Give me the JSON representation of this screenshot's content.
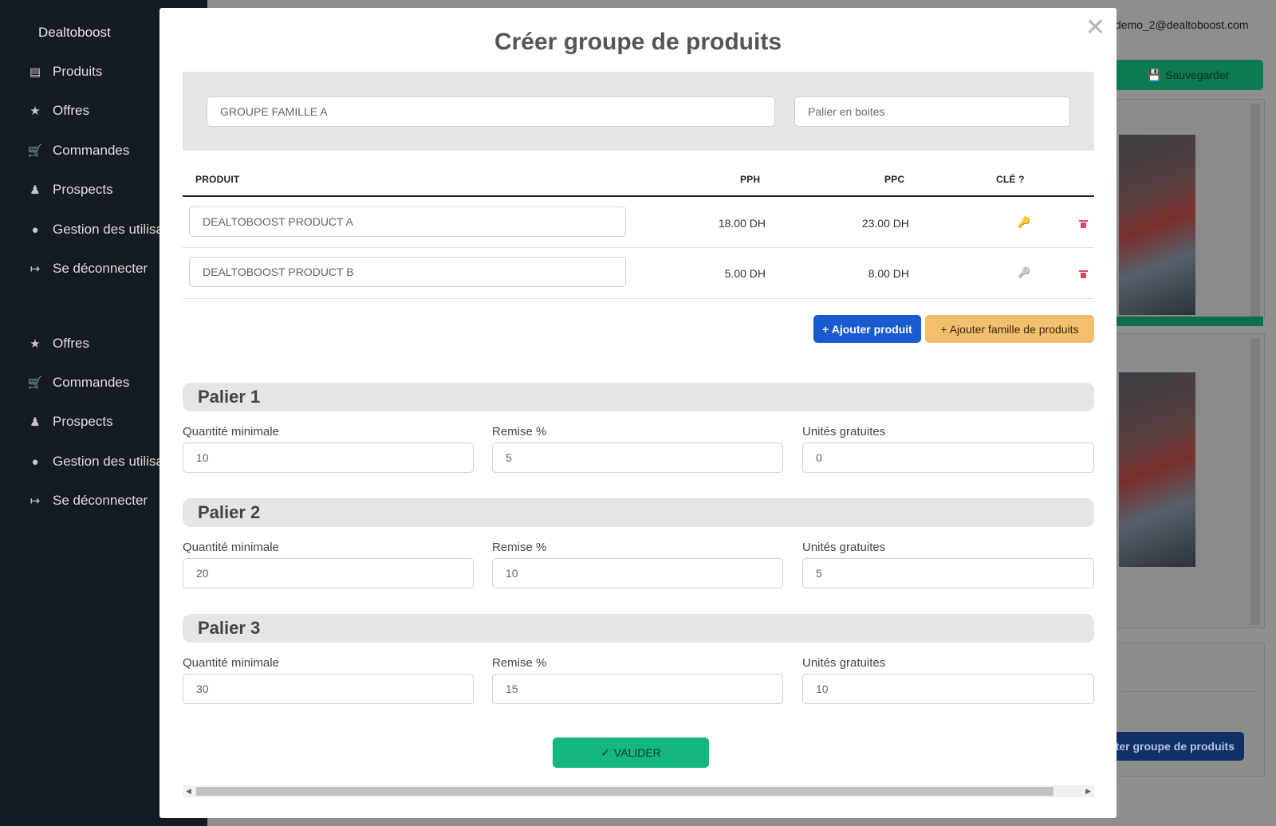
{
  "sidebar": {
    "brand": "Dealtoboost",
    "items": [
      {
        "label": "Produits",
        "icon": "document-icon"
      },
      {
        "label": "Offres",
        "icon": "star-icon"
      },
      {
        "label": "Commandes",
        "icon": "cart-icon"
      },
      {
        "label": "Prospects",
        "icon": "users-icon"
      },
      {
        "label": "Gestion des utilisa",
        "icon": "user-icon"
      },
      {
        "label": "Se déconnecter",
        "icon": "logout-icon"
      }
    ],
    "items2": [
      {
        "label": "Offres",
        "icon": "star-icon"
      },
      {
        "label": "Commandes",
        "icon": "cart-icon"
      },
      {
        "label": "Prospects",
        "icon": "users-icon"
      },
      {
        "label": "Gestion des utilisa",
        "icon": "user-icon"
      },
      {
        "label": "Se déconnecter",
        "icon": "logout-icon"
      }
    ]
  },
  "header": {
    "user_email": "demo_2@dealtoboost.com",
    "save_label": "Sauvegarder"
  },
  "background": {
    "create_group_button": "ter groupe de produits"
  },
  "modal": {
    "title": "Créer groupe de produits",
    "group_name": "GROUPE FAMILLE A",
    "palier_placeholder": "Palier en boites",
    "columns": {
      "produit": "PRODUIT",
      "pph": "PPH",
      "ppc": "PPC",
      "cle": "CLÉ ?"
    },
    "products": [
      {
        "name": "DEALTOBOOST PRODUCT A",
        "pph": "18.00 DH",
        "ppc": "23.00 DH",
        "key_active": true
      },
      {
        "name": "DEALTOBOOST PRODUCT B",
        "pph": "5.00 DH",
        "ppc": "8.00 DH",
        "key_active": false
      }
    ],
    "add_product_label": "+ Ajouter produit",
    "add_family_label": "+ Ajouter famille de produits",
    "paliers": [
      {
        "title": "Palier 1",
        "qty_label": "Quantité minimale",
        "qty": "10",
        "remise_label": "Remise %",
        "remise": "5",
        "free_label": "Unités gratuites",
        "free": "0"
      },
      {
        "title": "Palier 2",
        "qty_label": "Quantité minimale",
        "qty": "20",
        "remise_label": "Remise %",
        "remise": "10",
        "free_label": "Unités gratuites",
        "free": "5"
      },
      {
        "title": "Palier 3",
        "qty_label": "Quantité minimale",
        "qty": "30",
        "remise_label": "Remise %",
        "remise": "15",
        "free_label": "Unités gratuites",
        "free": "10"
      }
    ],
    "validate_label": "VALIDER"
  },
  "colors": {
    "sidebar_bg": "#151b23",
    "primary_blue": "#1a5ad0",
    "orange": "#f2bf6f",
    "green": "#14b87e",
    "key_active": "#f0a020",
    "key_inactive": "#666666",
    "delete_red": "#e0455a"
  }
}
